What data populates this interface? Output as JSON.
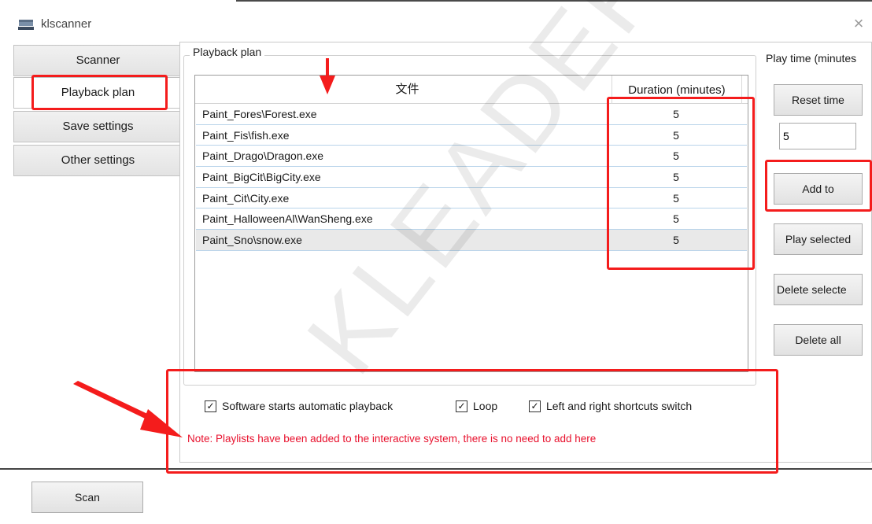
{
  "window": {
    "title": "klscanner",
    "close_symbol": "×"
  },
  "nav": {
    "tabs": [
      {
        "label": "Scanner"
      },
      {
        "label": "Playback plan"
      },
      {
        "label": "Save settings"
      },
      {
        "label": "Other settings"
      }
    ],
    "active": "Playback plan"
  },
  "playback": {
    "group_title": "Playback plan",
    "columns": {
      "file": "文件",
      "duration": "Duration (minutes)"
    },
    "rows": [
      {
        "file": "Paint_Fores\\Forest.exe",
        "duration": "5"
      },
      {
        "file": "Paint_Fis\\fish.exe",
        "duration": "5"
      },
      {
        "file": "Paint_Drago\\Dragon.exe",
        "duration": "5"
      },
      {
        "file": "Paint_BigCit\\BigCity.exe",
        "duration": "5"
      },
      {
        "file": "Paint_Cit\\City.exe",
        "duration": "5"
      },
      {
        "file": "Paint_HalloweenAl\\WanSheng.exe",
        "duration": "5"
      },
      {
        "file": "Paint_Sno\\snow.exe",
        "duration": "5"
      }
    ],
    "selected_row": 6,
    "options": {
      "auto_playback": {
        "label": "Software starts automatic playback",
        "checked": true
      },
      "loop": {
        "label": "Loop",
        "checked": true
      },
      "lr_shortcut": {
        "label": "Left and right shortcuts switch",
        "checked": true
      }
    },
    "note": "Note: Playlists have been added to the interactive system, there is no need to add here"
  },
  "side": {
    "play_time_label": "Play time (minutes",
    "reset_label": "Reset time",
    "time_value": "5",
    "add_label": "Add to",
    "play_selected_label": "Play selected",
    "delete_selected_label": "Delete selecte",
    "delete_all_label": "Delete all"
  },
  "footer": {
    "scan_label": "Scan"
  },
  "watermark": "KLEADER",
  "colors": {
    "annotation_red": "#f41c1c",
    "note_red": "#e8112d",
    "row_border": "#b9d4ea"
  }
}
